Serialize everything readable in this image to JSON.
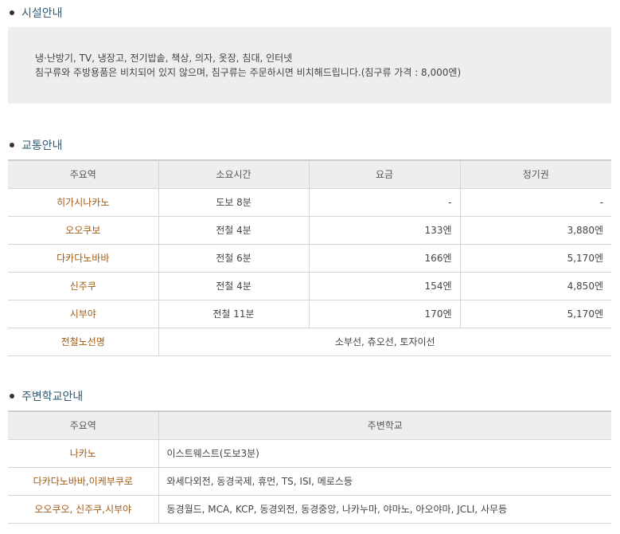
{
  "facility": {
    "title": "시설안내",
    "line1": "냉·난방기, TV, 냉장고, 전기밥솥, 책상, 의자, 옷장, 침대, 인터넷",
    "line2": "침구류와 주방용품은 비치되어 있지 않으며, 침구류는 주문하시면 비치해드립니다.(침구류 가격 : 8,000엔)"
  },
  "transport": {
    "title": "교통안내",
    "headers": [
      "주요역",
      "소요시간",
      "요금",
      "정기권"
    ],
    "rows": [
      {
        "station": "히가시나카노",
        "time": "도보 8분",
        "fare": "-",
        "pass": "-"
      },
      {
        "station": "오오쿠보",
        "time": "전철 4분",
        "fare": "133엔",
        "pass": "3,880엔"
      },
      {
        "station": "다카다노바바",
        "time": "전철 6분",
        "fare": "166엔",
        "pass": "5,170엔"
      },
      {
        "station": "신주쿠",
        "time": "전철 4분",
        "fare": "154엔",
        "pass": "4,850엔"
      },
      {
        "station": "시부야",
        "time": "전철 11분",
        "fare": "170엔",
        "pass": "5,170엔"
      }
    ],
    "line_label": "전철노선명",
    "line_value": "소부선, 츄오선, 토자이선"
  },
  "schools": {
    "title": "주변학교안내",
    "headers": [
      "주요역",
      "주변학교"
    ],
    "rows": [
      {
        "station": "나카노",
        "schools": "이스트웨스트(도보3분)"
      },
      {
        "station": "다카다노바바,이케부쿠로",
        "schools": "와세다외전, 동경국제, 휴먼, TS, ISI, 메로스등"
      },
      {
        "station": "오오쿠오, 신주쿠,시부야",
        "schools": "동경월드, MCA, KCP, 동경외전, 동경중앙, 나카누마, 야마노, 아오야마, JCLI, 사무등"
      }
    ]
  }
}
